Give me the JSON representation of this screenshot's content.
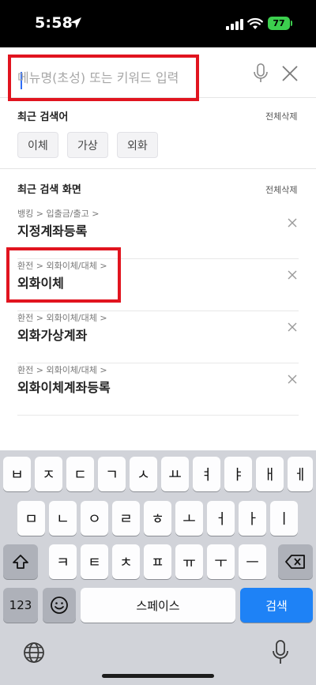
{
  "status_bar": {
    "time": "5:58",
    "battery": "77"
  },
  "search": {
    "placeholder": "메뉴명(초성) 또는 키워드 입력",
    "value": ""
  },
  "recent_searches": {
    "title": "최근 검색어",
    "clear_label": "전체삭제",
    "chips": [
      "이체",
      "가상",
      "외화"
    ]
  },
  "recent_screens": {
    "title": "최근 검색 화면",
    "clear_label": "전체삭제",
    "items": [
      {
        "path": "뱅킹 > 입출금/출고 >",
        "name": "지정계좌등록"
      },
      {
        "path": "환전 > 외화이체/대체 >",
        "name": "외화이체"
      },
      {
        "path": "환전 > 외화이체/대체 >",
        "name": "외화가상계좌"
      },
      {
        "path": "환전 > 외화이체/대체 >",
        "name": "외화이체계좌등록"
      }
    ]
  },
  "keyboard": {
    "row1": [
      "ㅂ",
      "ㅈ",
      "ㄷ",
      "ㄱ",
      "ㅅ",
      "ㅛ",
      "ㅕ",
      "ㅑ",
      "ㅐ",
      "ㅔ"
    ],
    "row2": [
      "ㅁ",
      "ㄴ",
      "ㅇ",
      "ㄹ",
      "ㅎ",
      "ㅗ",
      "ㅓ",
      "ㅏ",
      "ㅣ"
    ],
    "row3": [
      "ㅋ",
      "ㅌ",
      "ㅊ",
      "ㅍ",
      "ㅠ",
      "ㅜ",
      "ㅡ"
    ],
    "numbers_label": "123",
    "space_label": "스페이스",
    "search_label": "검색"
  },
  "colors": {
    "highlight": "#e1141f",
    "search_key": "#1e82f6",
    "keyboard_bg": "#d1d3d9"
  }
}
